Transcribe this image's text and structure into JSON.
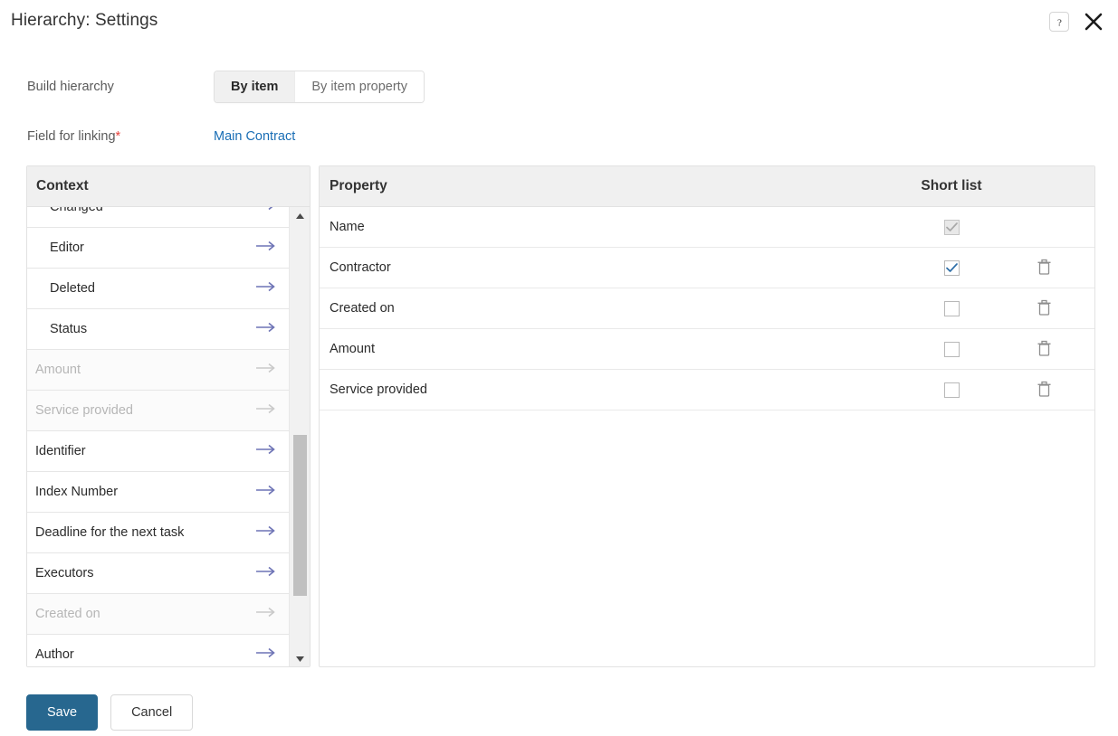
{
  "window": {
    "title": "Hierarchy: Settings",
    "help_icon": "question-mark-icon",
    "close_icon": "close-icon"
  },
  "form": {
    "build_hierarchy": {
      "label": "Build hierarchy",
      "options": [
        "By item",
        "By item property"
      ],
      "selected": "By item"
    },
    "field_for_linking": {
      "label": "Field for linking",
      "required_marker": "*",
      "value": "Main Contract"
    }
  },
  "context_panel": {
    "header": "Context",
    "items": [
      {
        "label": "Changed",
        "disabled": false,
        "indent": true,
        "clipped": true
      },
      {
        "label": "Editor",
        "disabled": false,
        "indent": true
      },
      {
        "label": "Deleted",
        "disabled": false,
        "indent": true
      },
      {
        "label": "Status",
        "disabled": false,
        "indent": true
      },
      {
        "label": "Amount",
        "disabled": true,
        "indent": false
      },
      {
        "label": "Service provided",
        "disabled": true,
        "indent": false
      },
      {
        "label": "Identifier",
        "disabled": false,
        "indent": false
      },
      {
        "label": "Index Number",
        "disabled": false,
        "indent": false
      },
      {
        "label": "Deadline for the next task",
        "disabled": false,
        "indent": false
      },
      {
        "label": "Executors",
        "disabled": false,
        "indent": false
      },
      {
        "label": "Created on",
        "disabled": true,
        "indent": false
      },
      {
        "label": "Author",
        "disabled": false,
        "indent": false
      }
    ],
    "row_arrow_icon": "arrow-right-icon",
    "scrollbar": {
      "up_icon": "scroll-up-arrow-icon",
      "down_icon": "scroll-down-arrow-icon"
    }
  },
  "property_panel": {
    "columns": [
      "Property",
      "Short list"
    ],
    "rows": [
      {
        "name": "Name",
        "short_list": true,
        "checkbox_disabled": true,
        "deletable": false
      },
      {
        "name": "Contractor",
        "short_list": true,
        "checkbox_disabled": false,
        "deletable": true
      },
      {
        "name": "Created on",
        "short_list": false,
        "checkbox_disabled": false,
        "deletable": true
      },
      {
        "name": "Amount",
        "short_list": false,
        "checkbox_disabled": false,
        "deletable": true
      },
      {
        "name": "Service provided",
        "short_list": false,
        "checkbox_disabled": false,
        "deletable": true
      }
    ],
    "delete_icon": "trash-icon"
  },
  "footer": {
    "save_label": "Save",
    "cancel_label": "Cancel"
  },
  "colors": {
    "primary_button": "#27678f",
    "link": "#1a6eb5",
    "required_asterisk": "#e8413a",
    "arrow": "#6d73b5",
    "header_bg": "#f0f0f0",
    "checkbox_check": "#2f6fa8"
  }
}
